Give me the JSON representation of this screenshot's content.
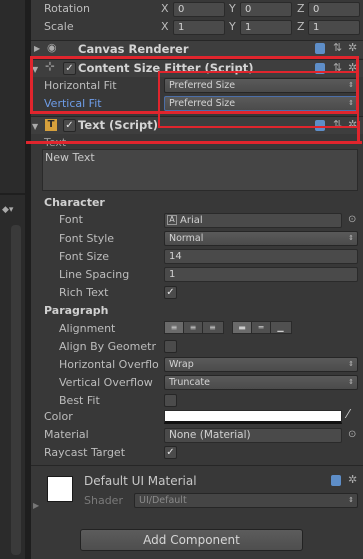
{
  "transform": {
    "rotation": {
      "label": "Rotation",
      "x_axis": "X",
      "x": "0",
      "y_axis": "Y",
      "y": "0",
      "z_axis": "Z",
      "z": "0"
    },
    "scale": {
      "label": "Scale",
      "x_axis": "X",
      "x": "1",
      "y_axis": "Y",
      "y": "1",
      "z_axis": "Z",
      "z": "1"
    }
  },
  "canvas_renderer": {
    "title": "Canvas Renderer"
  },
  "content_size_fitter": {
    "title": "Content Size Fitter (Script)",
    "horizontal_fit": {
      "label": "Horizontal Fit",
      "value": "Preferred Size"
    },
    "vertical_fit": {
      "label": "Vertical Fit",
      "value": "Preferred Size"
    }
  },
  "text_component": {
    "title": "Text (Script)",
    "text_label": "Text",
    "text_value": "New Text",
    "character_section": "Character",
    "font": {
      "label": "Font",
      "value": "Arial",
      "icon_letter": "A"
    },
    "font_style": {
      "label": "Font Style",
      "value": "Normal"
    },
    "font_size": {
      "label": "Font Size",
      "value": "14"
    },
    "line_spacing": {
      "label": "Line Spacing",
      "value": "1"
    },
    "rich_text": {
      "label": "Rich Text",
      "checked": true
    },
    "paragraph_section": "Paragraph",
    "alignment": {
      "label": "Alignment"
    },
    "align_by_geometry": {
      "label": "Align By Geometr",
      "checked": false
    },
    "horizontal_overflow": {
      "label": "Horizontal Overflo",
      "value": "Wrap"
    },
    "vertical_overflow": {
      "label": "Vertical Overflow",
      "value": "Truncate"
    },
    "best_fit": {
      "label": "Best Fit",
      "checked": false
    },
    "color": {
      "label": "Color",
      "value": "#ffffff"
    },
    "material": {
      "label": "Material",
      "value": "None (Material)"
    },
    "raycast_target": {
      "label": "Raycast Target",
      "checked": true
    }
  },
  "material_preview": {
    "name": "Default UI Material",
    "shader_label": "Shader",
    "shader_value": "UI/Default"
  },
  "add_component_label": "Add Component",
  "colors": {
    "highlight_red": "#e0252d",
    "selected_label_blue": "#6e9de8",
    "panel_bg": "#383838"
  }
}
